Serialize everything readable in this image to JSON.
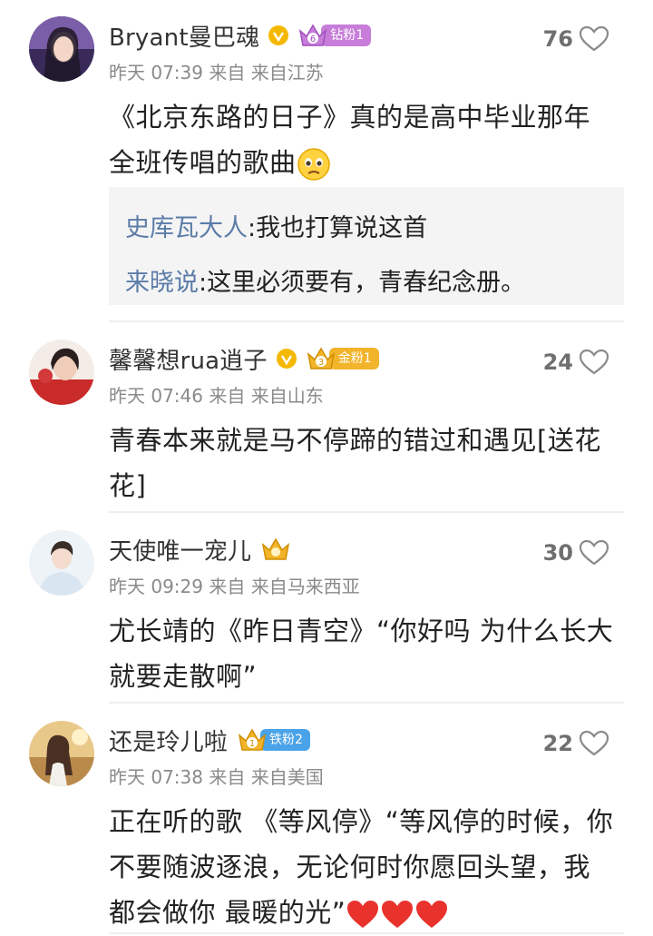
{
  "comments": [
    {
      "username": "Bryant曼巴魂",
      "verified": true,
      "fan_level": "6",
      "fan_badge": "钻粉1",
      "fan_color": "#c77dd9",
      "time": "昨天 07:39",
      "source": "来自",
      "location": "来自江苏",
      "likes": "76",
      "text_line1": "《北京东路的日子》真的是高中毕业那年",
      "text_line2": "全班传唱的歌曲",
      "replies": [
        {
          "user": "史库瓦大人",
          "text": ":我也打算说这首"
        },
        {
          "user": "来晓说",
          "text": ":这里必须要有，青春纪念册。"
        }
      ]
    },
    {
      "username": "馨馨想rua逍子",
      "verified": true,
      "fan_level": "3",
      "fan_badge": "金粉1",
      "fan_color": "#f2b42a",
      "time": "昨天 07:46",
      "source": "来自",
      "location": "来自山东",
      "likes": "24",
      "text_line1": "青春本来就是马不停蹄的错过和遇见[送花",
      "text_line2": "花]"
    },
    {
      "username": "天使唯一宠儿",
      "verified": false,
      "time": "昨天 09:29",
      "source": "来自",
      "location": "来自马来西亚",
      "likes": "30",
      "text_line1": "尤长靖的《昨日青空》“你好吗 为什么长大",
      "text_line2": "就要走散啊”"
    },
    {
      "username": "还是玲儿啦",
      "verified": false,
      "fan_level": "1",
      "fan_badge": "铁粉2",
      "fan_color": "#4aa3e8",
      "time": "昨天 07:38",
      "source": "来自",
      "location": "来自美国",
      "likes": "22",
      "text_line1": "正在听的歌 《等风停》“等风停的时候，你",
      "text_line2": "不要随波逐浪，无论何时你愿回头望，我",
      "text_line3": "都会做你 最暖的光”"
    }
  ],
  "icons": {
    "like": "heart-outline-icon",
    "verified": "verified-v-icon",
    "crown": "crown-icon",
    "emoji_sad": "pleading-face-emoji",
    "emoji_heart": "red-heart-emoji"
  },
  "colors": {
    "reply_user": "#5b7ca8",
    "meta_gray": "#8a8a8a",
    "verified_gold": "#f5b800",
    "heart_red": "#e8322b"
  }
}
